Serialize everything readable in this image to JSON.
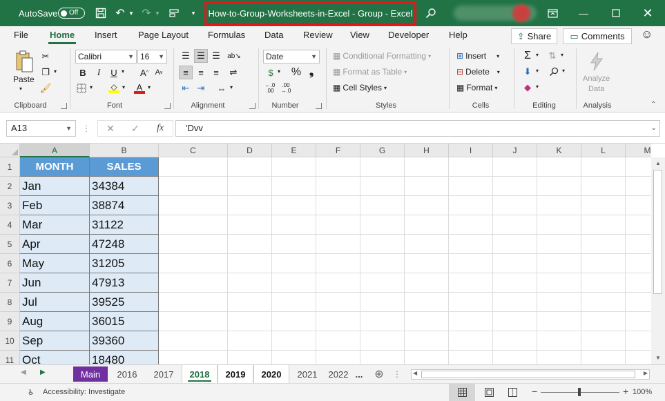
{
  "titlebar": {
    "autosave_label": "AutoSave",
    "autosave_state": "Off",
    "title": "How-to-Group-Worksheets-in-Excel  -  Group  -  Excel"
  },
  "menu": {
    "tabs": [
      "File",
      "Home",
      "Insert",
      "Page Layout",
      "Formulas",
      "Data",
      "Review",
      "View",
      "Developer",
      "Help"
    ],
    "active": "Home",
    "share_label": "Share",
    "comments_label": "Comments"
  },
  "ribbon": {
    "clipboard": {
      "paste": "Paste",
      "label": "Clipboard"
    },
    "font": {
      "name": "Calibri",
      "size": "16",
      "label": "Font"
    },
    "alignment": {
      "label": "Alignment"
    },
    "number": {
      "format": "Date",
      "label": "Number"
    },
    "styles": {
      "conditional": "Conditional Formatting",
      "format_table": "Format as Table",
      "cell_styles": "Cell Styles",
      "label": "Styles"
    },
    "cells": {
      "insert": "Insert",
      "delete": "Delete",
      "format": "Format",
      "label": "Cells"
    },
    "editing": {
      "label": "Editing"
    },
    "analysis": {
      "analyze_line1": "Analyze",
      "analyze_line2": "Data",
      "label": "Analysis"
    }
  },
  "formula_bar": {
    "name_box": "A13",
    "formula": "'Dvv"
  },
  "grid": {
    "columns": [
      "A",
      "B",
      "C",
      "D",
      "E",
      "F",
      "G",
      "H",
      "I",
      "J",
      "K",
      "L",
      "M"
    ],
    "rows": [
      "1",
      "2",
      "3",
      "4",
      "5",
      "6",
      "7",
      "8",
      "9",
      "10",
      "11"
    ],
    "header": [
      "MONTH",
      "SALES"
    ],
    "data": [
      [
        "Jan",
        "34384"
      ],
      [
        "Feb",
        "38874"
      ],
      [
        "Mar",
        "31122"
      ],
      [
        "Apr",
        "47248"
      ],
      [
        "May",
        "31205"
      ],
      [
        "Jun",
        "47913"
      ],
      [
        "Jul",
        "39525"
      ],
      [
        "Aug",
        "36015"
      ],
      [
        "Sep",
        "39360"
      ],
      [
        "Oct",
        "18480"
      ]
    ]
  },
  "sheets": {
    "tabs": [
      "Main",
      "2016",
      "2017",
      "2018",
      "2019",
      "2020",
      "2021",
      "2022"
    ],
    "more": "...",
    "active": "2018"
  },
  "status": {
    "accessibility": "Accessibility: Investigate",
    "zoom": "100%"
  }
}
